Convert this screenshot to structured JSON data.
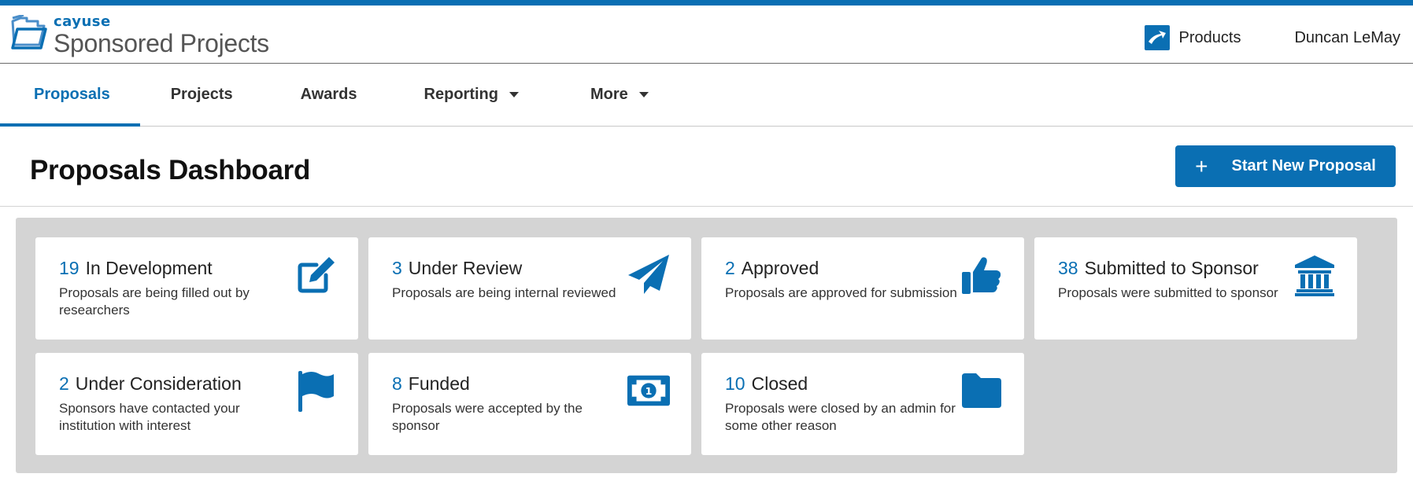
{
  "brand": {
    "small": "cayuse",
    "name": "Sponsored Projects"
  },
  "header": {
    "products_label": "Products",
    "user_name": "Duncan LeMay"
  },
  "nav": {
    "tabs": [
      {
        "label": "Proposals",
        "active": true
      },
      {
        "label": "Projects"
      },
      {
        "label": "Awards"
      },
      {
        "label": "Reporting",
        "dropdown": true
      },
      {
        "label": "More",
        "dropdown": true
      }
    ]
  },
  "page": {
    "title": "Proposals Dashboard",
    "start_button": "Start New Proposal"
  },
  "cards": [
    {
      "count": "19",
      "title": "In Development",
      "desc": "Proposals are being filled out by researchers",
      "icon": "edit-icon"
    },
    {
      "count": "3",
      "title": "Under Review",
      "desc": "Proposals are being internal reviewed",
      "icon": "paper-plane-icon"
    },
    {
      "count": "2",
      "title": "Approved",
      "desc": "Proposals are approved for submission",
      "icon": "thumbs-up-icon"
    },
    {
      "count": "38",
      "title": "Submitted to Sponsor",
      "desc": "Proposals were submitted to sponsor",
      "icon": "institution-icon"
    },
    {
      "count": "2",
      "title": "Under Consideration",
      "desc": "Sponsors have contacted your institution with interest",
      "icon": "flag-icon"
    },
    {
      "count": "8",
      "title": "Funded",
      "desc": "Proposals were accepted by the sponsor",
      "icon": "money-bill-icon"
    },
    {
      "count": "10",
      "title": "Closed",
      "desc": "Proposals were closed by an admin for some other reason",
      "icon": "folder-icon"
    }
  ],
  "colors": {
    "accent": "#0a6fb3",
    "board_bg": "#d4d4d4"
  }
}
